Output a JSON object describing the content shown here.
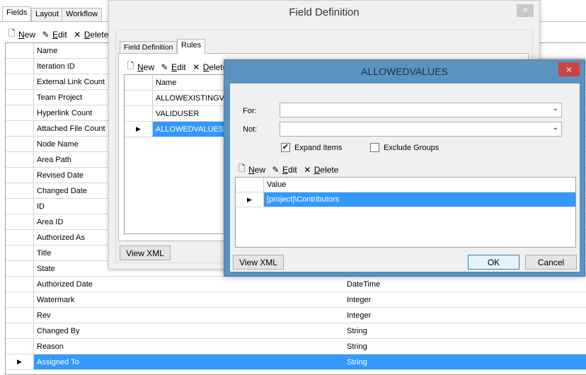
{
  "main": {
    "tabs": [
      {
        "label": "Fields"
      },
      {
        "label": "Layout"
      },
      {
        "label": "Workflow"
      }
    ],
    "toolbar": {
      "new": "New",
      "edit": "Edit",
      "delete": "Delete"
    },
    "grid": {
      "header": "Name",
      "rows": [
        {
          "name": "Iteration ID",
          "type": ""
        },
        {
          "name": "External Link Count",
          "type": ""
        },
        {
          "name": "Team Project",
          "type": ""
        },
        {
          "name": "Hyperlink Count",
          "type": ""
        },
        {
          "name": "Attached File Count",
          "type": ""
        },
        {
          "name": "Node Name",
          "type": ""
        },
        {
          "name": "Area Path",
          "type": ""
        },
        {
          "name": "Revised Date",
          "type": ""
        },
        {
          "name": "Changed Date",
          "type": ""
        },
        {
          "name": "ID",
          "type": ""
        },
        {
          "name": "Area ID",
          "type": ""
        },
        {
          "name": "Authorized As",
          "type": ""
        },
        {
          "name": "Title",
          "type": ""
        },
        {
          "name": "State",
          "type": ""
        },
        {
          "name": "Authorized Date",
          "type": "DateTime"
        },
        {
          "name": "Watermark",
          "type": "Integer"
        },
        {
          "name": "Rev",
          "type": "Integer"
        },
        {
          "name": "Changed By",
          "type": "String"
        },
        {
          "name": "Reason",
          "type": "String"
        },
        {
          "name": "Assigned To",
          "type": "String",
          "selected": true
        }
      ]
    }
  },
  "field_definition": {
    "title": "Field Definition",
    "close": "×",
    "tabs": [
      {
        "label": "Field Definition"
      },
      {
        "label": "Rules"
      }
    ],
    "toolbar": {
      "new": "New",
      "edit": "Edit",
      "delete": "Delete"
    },
    "grid": {
      "header": "Name",
      "rows": [
        {
          "name": "ALLOWEXISTINGVALUE"
        },
        {
          "name": "VALIDUSER"
        },
        {
          "name": "ALLOWEDVALUES",
          "selected": true
        }
      ]
    },
    "view_xml": "View XML"
  },
  "allowed_values": {
    "title": "ALLOWEDVALUES",
    "close": "×",
    "for_label": "For:",
    "for_value": "",
    "not_label": "Not:",
    "not_value": "",
    "expand_items": {
      "label": "Expand Items",
      "checked": true
    },
    "exclude_groups": {
      "label": "Exclude Groups",
      "checked": false
    },
    "toolbar": {
      "new": "New",
      "edit": "Edit",
      "delete": "Delete"
    },
    "grid": {
      "header": "Value",
      "rows": [
        {
          "value": "[project]\\Contributors",
          "selected": true
        }
      ]
    },
    "view_xml": "View XML",
    "ok": "OK",
    "cancel": "Cancel"
  },
  "colors": {
    "selection": "#3399ff",
    "dialog_frame": "#5a93c0",
    "close_red": "#c7463f"
  }
}
